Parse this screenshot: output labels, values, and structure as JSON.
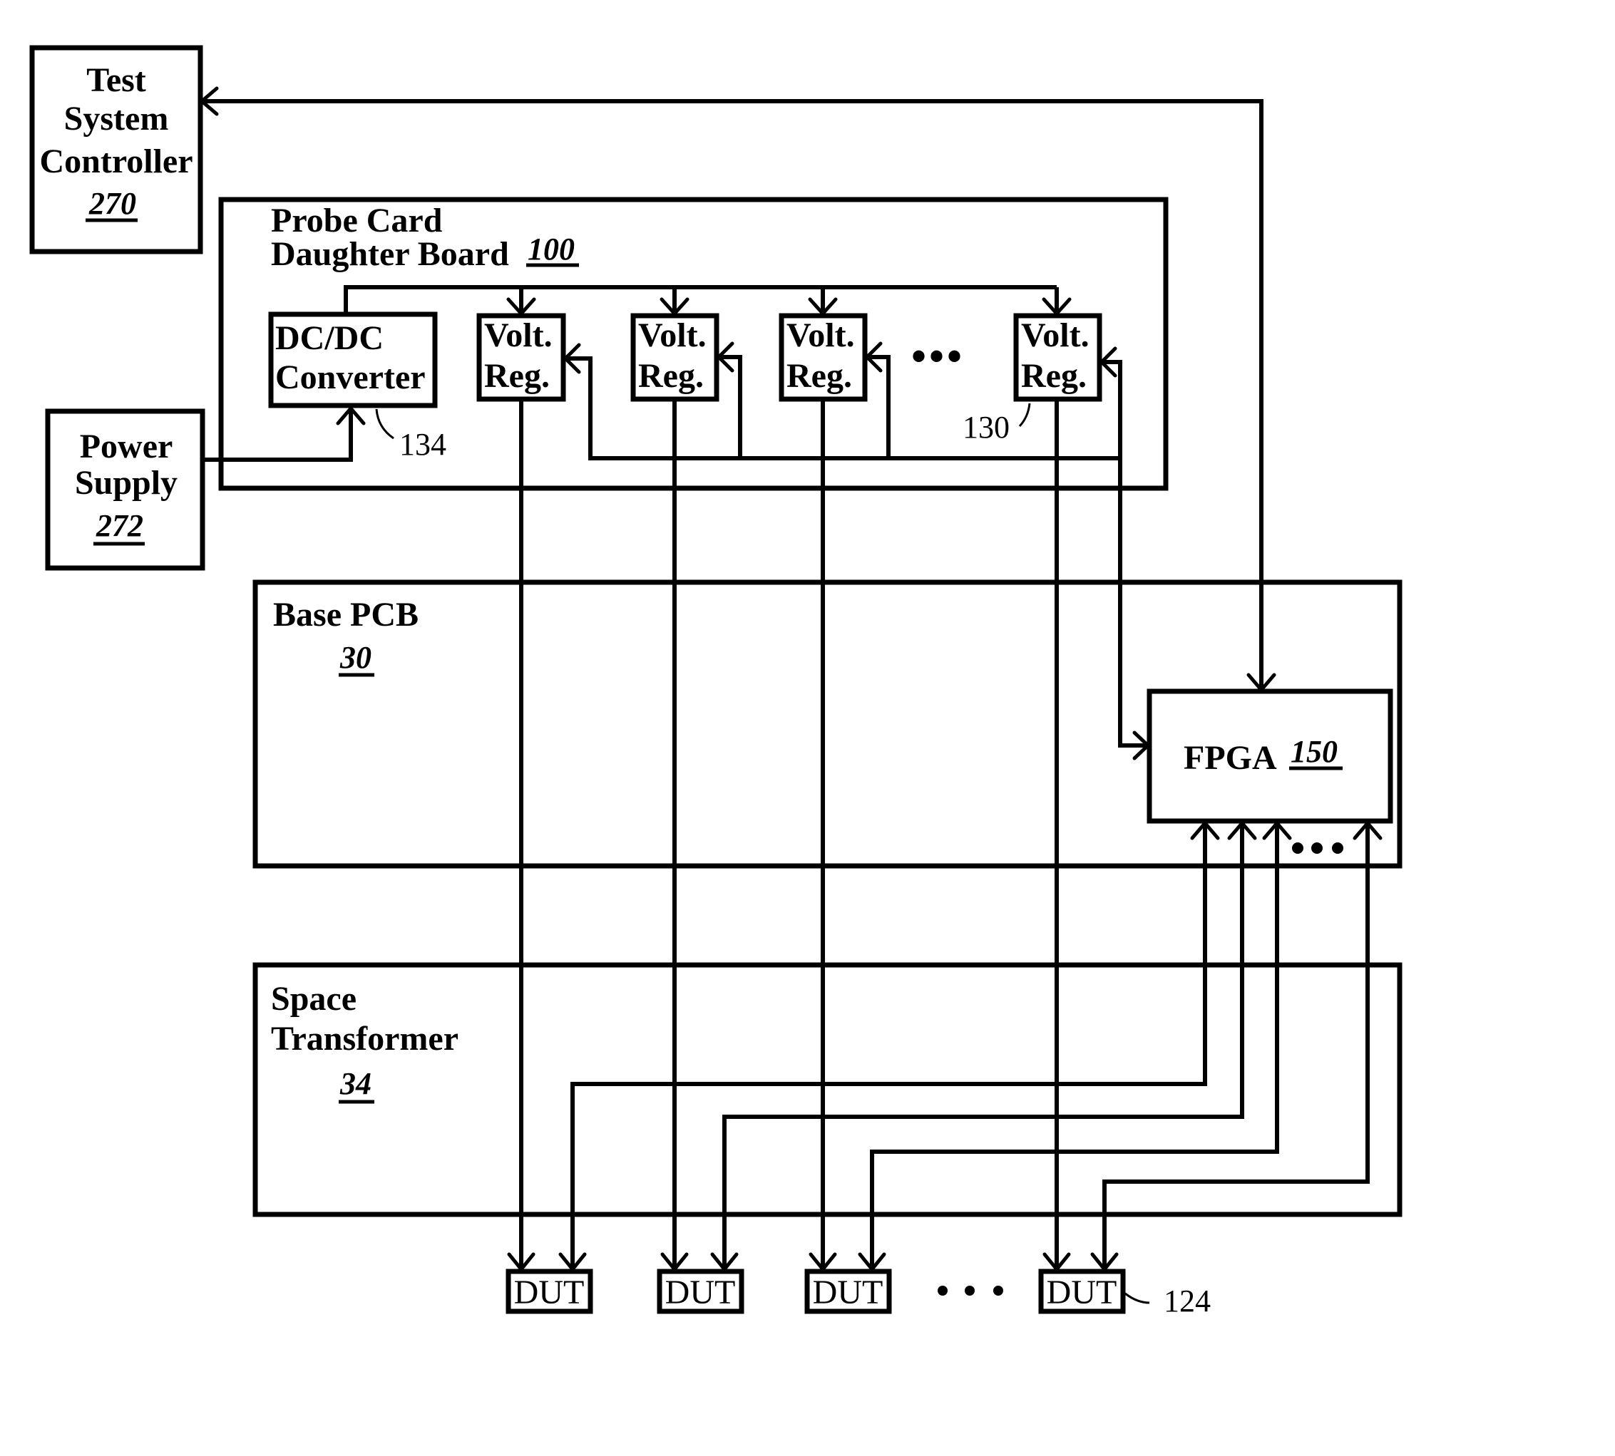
{
  "figure": {
    "components": {
      "test_system_controller": {
        "lines": [
          "Test",
          "System",
          "Controller"
        ],
        "ref": "270"
      },
      "power_supply": {
        "lines": [
          "Power",
          "Supply"
        ],
        "ref": "272"
      },
      "probe_card_daughter_board": {
        "lines": [
          "Probe Card",
          "Daughter Board"
        ],
        "ref": "100"
      },
      "dc_dc_converter": {
        "lines": [
          "DC/DC",
          "Converter"
        ],
        "ref_label": "134"
      },
      "voltage_regulators": {
        "items": [
          {
            "lines": [
              "Volt.",
              "Reg."
            ]
          },
          {
            "lines": [
              "Volt.",
              "Reg."
            ]
          },
          {
            "lines": [
              "Volt.",
              "Reg."
            ]
          },
          {
            "lines": [
              "Volt.",
              "Reg."
            ]
          }
        ],
        "ref_label": "130",
        "ellipsis": "•••"
      },
      "base_pcb": {
        "lines": [
          "Base PCB"
        ],
        "ref": "30"
      },
      "fpga": {
        "label": "FPGA",
        "ref": "150",
        "inputs_ellipsis": "•••"
      },
      "space_transformer": {
        "lines": [
          "Space",
          "Transformer"
        ],
        "ref": "34"
      },
      "duts": {
        "items": [
          {
            "label": "DUT"
          },
          {
            "label": "DUT"
          },
          {
            "label": "DUT"
          },
          {
            "label": "DUT"
          }
        ],
        "ref_label": "124",
        "ellipsis": "•••"
      }
    },
    "connections": [
      {
        "from": "power_supply",
        "to": "dc_dc_converter"
      },
      {
        "from": "dc_dc_converter",
        "to": "voltage_regulators"
      },
      {
        "from": "fpga",
        "to": "test_system_controller",
        "bidirectional": true
      },
      {
        "from": "fpga",
        "to": "voltage_regulators",
        "bidirectional": true,
        "note": "control bus"
      },
      {
        "from": "voltage_regulators",
        "to": "duts"
      },
      {
        "from": "fpga",
        "to": "duts",
        "bidirectional": true
      }
    ]
  }
}
